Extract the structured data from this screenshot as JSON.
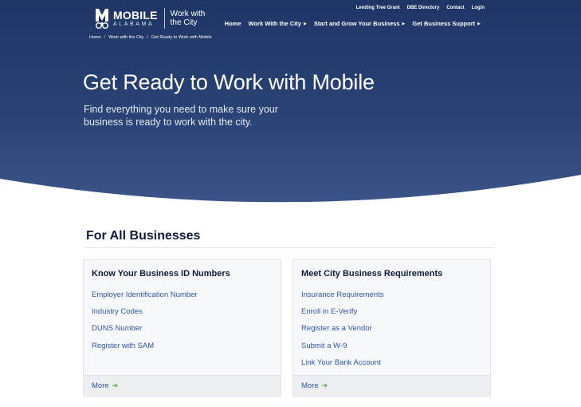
{
  "header": {
    "logo": {
      "city": "MOBILE",
      "state": "ALABAMA",
      "subtitle": "Work with the City"
    },
    "utility_nav": [
      "Lending Tree Grant",
      "DBE Directory",
      "Contact",
      "Login"
    ],
    "main_nav": [
      {
        "label": "Home",
        "has_submenu": false
      },
      {
        "label": "Work With the City",
        "has_submenu": true
      },
      {
        "label": "Start and Grow Your Business",
        "has_submenu": true
      },
      {
        "label": "Get Business Support",
        "has_submenu": true
      }
    ],
    "breadcrumb": [
      "Home",
      "Work with the City",
      "Get Ready to Work with Mobile"
    ],
    "breadcrumb_separator": "/"
  },
  "hero": {
    "title": "Get Ready to Work with Mobile",
    "subtitle": "Find everything you need to make sure your business is ready to work with the city."
  },
  "section": {
    "title": "For All Businesses"
  },
  "cards": [
    {
      "title": "Know Your Business ID Numbers",
      "links": [
        "Employer Identification Number",
        "Industry Codes",
        "DUNS Number",
        "Register with SAM"
      ],
      "more_label": "More"
    },
    {
      "title": "Meet City Business Requirements",
      "links": [
        "Insurance Requirements",
        "Enroll in E-Verify",
        "Register as a Vendor",
        "Submit a W-9",
        "Link Your Bank Account"
      ],
      "more_label": "More"
    }
  ],
  "icons": {
    "caret": "chevron-right-icon",
    "more_arrow": "arrow-right-icon",
    "logo_mark": "mobile-logo-icon"
  },
  "colors": {
    "hero_dark": "#1f3566",
    "hero_light": "#3c5689",
    "link": "#2d56a4",
    "heading": "#0f1b3a",
    "arrow": "#58a83a",
    "card_bg": "#f7f8fb"
  }
}
